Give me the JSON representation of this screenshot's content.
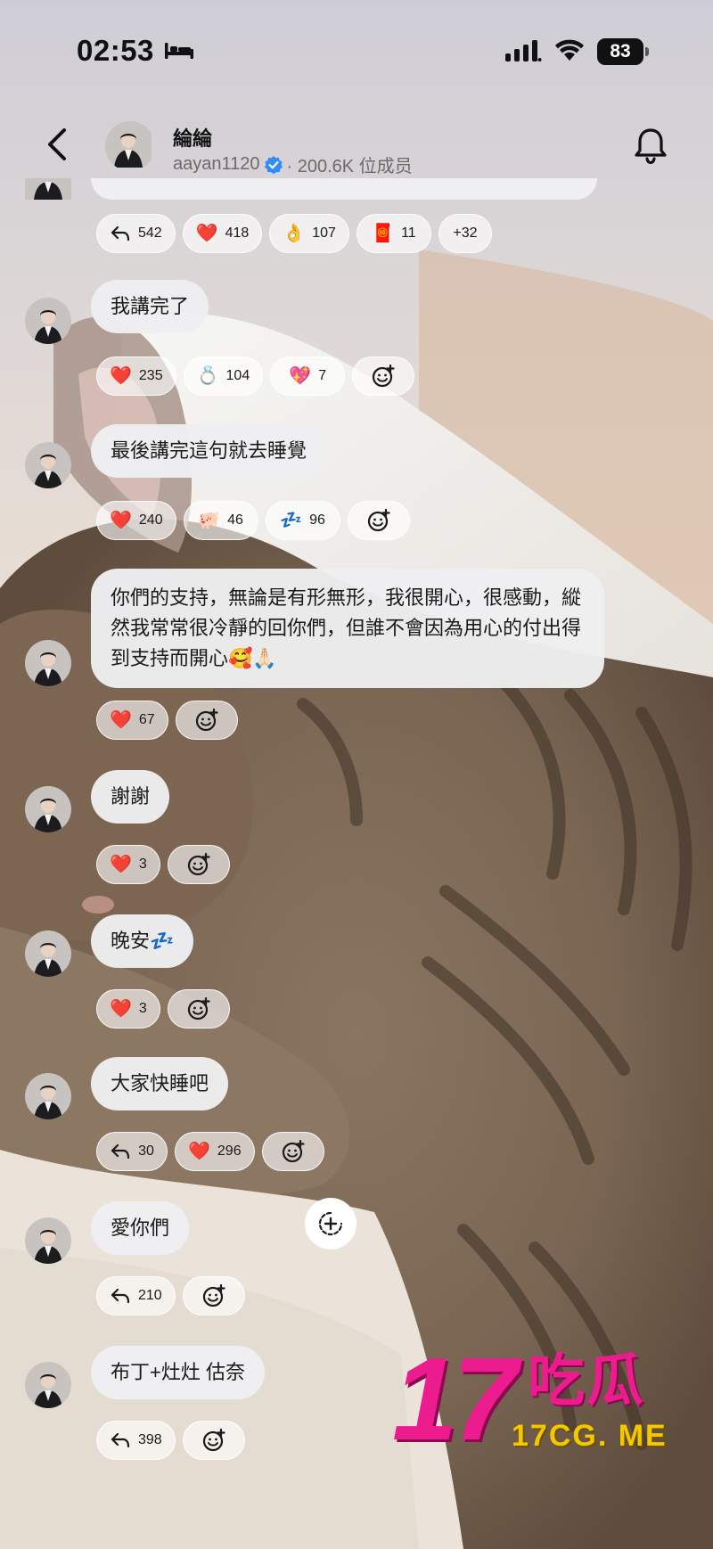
{
  "status_bar": {
    "time": "02:53",
    "battery": "83",
    "icons": [
      "bed-icon",
      "cellular-signal-icon",
      "wifi-icon",
      "battery-icon"
    ]
  },
  "header": {
    "channel_name": "綸綸",
    "handle": "aayan1120",
    "members": "· 200.6K 位成员",
    "icons": [
      "back-arrow-icon",
      "verified-badge-icon",
      "bell-icon"
    ]
  },
  "messages": [
    {
      "text": "",
      "reactions": [
        {
          "icon": "reply-arrow-icon",
          "count": "542"
        },
        {
          "icon": "red-heart-emoji",
          "emoji": "❤️",
          "count": "418"
        },
        {
          "icon": "ok-hand-emoji",
          "emoji": "👌",
          "count": "107"
        },
        {
          "icon": "red-envelope-emoji",
          "emoji": "🧧",
          "count": "11"
        },
        {
          "icon": "",
          "count": "+32"
        }
      ]
    },
    {
      "text": "我講完了",
      "reactions": [
        {
          "icon": "red-heart-emoji",
          "emoji": "❤️",
          "count": "235"
        },
        {
          "icon": "ring-emoji",
          "emoji": "💍",
          "count": "104"
        },
        {
          "icon": "sparkling-heart-emoji",
          "emoji": "💖",
          "count": "7"
        }
      ]
    },
    {
      "text": "最後講完這句就去睡覺",
      "reactions": [
        {
          "icon": "red-heart-emoji",
          "emoji": "❤️",
          "count": "240"
        },
        {
          "icon": "pig-emoji",
          "emoji": "🐖",
          "count": "46"
        },
        {
          "icon": "zzz-emoji",
          "emoji": "💤",
          "count": "96"
        }
      ]
    },
    {
      "text": "你們的支持，無論是有形無形，我很開心，很感動，縱然我常常很冷靜的回你們，但誰不會因為用心的付出得到支持而開心🥰🙏🏻",
      "reactions": [
        {
          "icon": "red-heart-emoji",
          "emoji": "❤️",
          "count": "67"
        }
      ]
    },
    {
      "text": "謝謝",
      "reactions": [
        {
          "icon": "red-heart-emoji",
          "emoji": "❤️",
          "count": "3"
        }
      ]
    },
    {
      "text": "晚安💤",
      "reactions": [
        {
          "icon": "red-heart-emoji",
          "emoji": "❤️",
          "count": "3"
        }
      ]
    },
    {
      "text": "大家快睡吧",
      "reactions": [
        {
          "icon": "reply-arrow-icon",
          "count": "30"
        },
        {
          "icon": "red-heart-emoji",
          "emoji": "❤️",
          "count": "296"
        }
      ]
    },
    {
      "text": "愛你們",
      "reactions": [
        {
          "icon": "reply-arrow-icon",
          "count": "210"
        }
      ]
    },
    {
      "text": "布丁+灶灶 估奈",
      "reactions": [
        {
          "icon": "reply-arrow-icon",
          "count": "398"
        }
      ]
    }
  ],
  "watermark": {
    "big": "17",
    "cn": "吃瓜",
    "url": "17CG. ME"
  },
  "colors": {
    "watermark_pink": "#ec1b8e",
    "watermark_yellow": "#f3c800",
    "verified_blue": "#2f8df5"
  }
}
